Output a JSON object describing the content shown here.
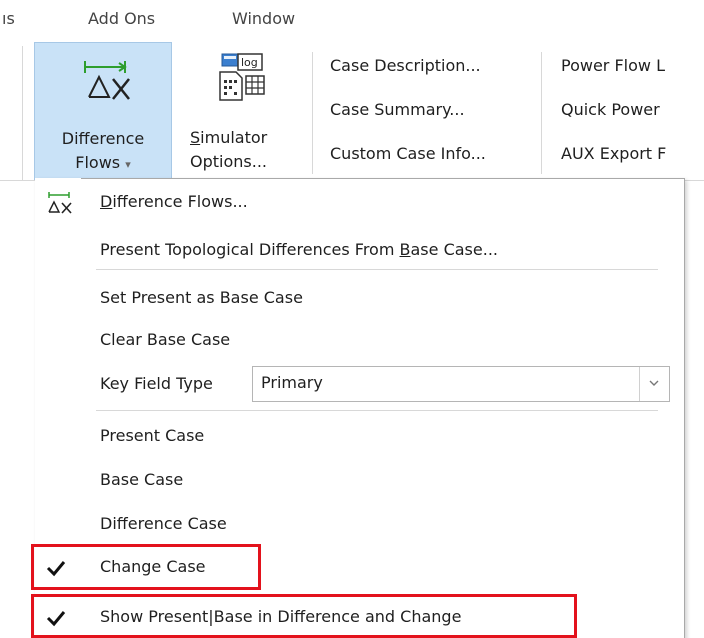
{
  "menu_tabs": [
    {
      "label": "ıs"
    },
    {
      "label": "Add Ons"
    },
    {
      "label": "Window"
    }
  ],
  "ribbon": {
    "difference_flows": {
      "line1": "Difference",
      "line2": "Flows",
      "dropdown_glyph": "▾",
      "icon": "difference-flows-icon"
    },
    "simulator_options": {
      "line1_prefix": "",
      "line1_underlined": "S",
      "line1_rest": "imulator",
      "line2": "Options...",
      "icon": "simulator-options-icon"
    },
    "case_group": [
      "Case Description...",
      "Case Summary...",
      "Custom Case Info..."
    ],
    "power_flow_group": [
      "Power Flow L",
      "Quick Power",
      "AUX Export F"
    ]
  },
  "dropdown": {
    "item_difference_flows": {
      "underlined": "D",
      "rest": "ifference Flows..."
    },
    "item_topological": {
      "before": "Present Topological Differences From ",
      "underlined": "B",
      "after": "ase Case..."
    },
    "item_set_base": "Set Present as Base Case",
    "item_clear_base": "Clear Base Case",
    "key_field": {
      "label": "Key Field Type",
      "value": "Primary"
    },
    "item_present_case": "Present Case",
    "item_base_case": "Base Case",
    "item_difference_case": "Difference Case",
    "item_change_case": {
      "label": "Change Case",
      "checked": true
    },
    "item_show_present_base": {
      "label": "Show Present|Base in Difference and Change",
      "checked": true
    }
  },
  "colors": {
    "selected_ribbon_bg": "#c9e2f7",
    "highlight_red": "#e3121c",
    "icon_green": "#2e9e2e"
  }
}
